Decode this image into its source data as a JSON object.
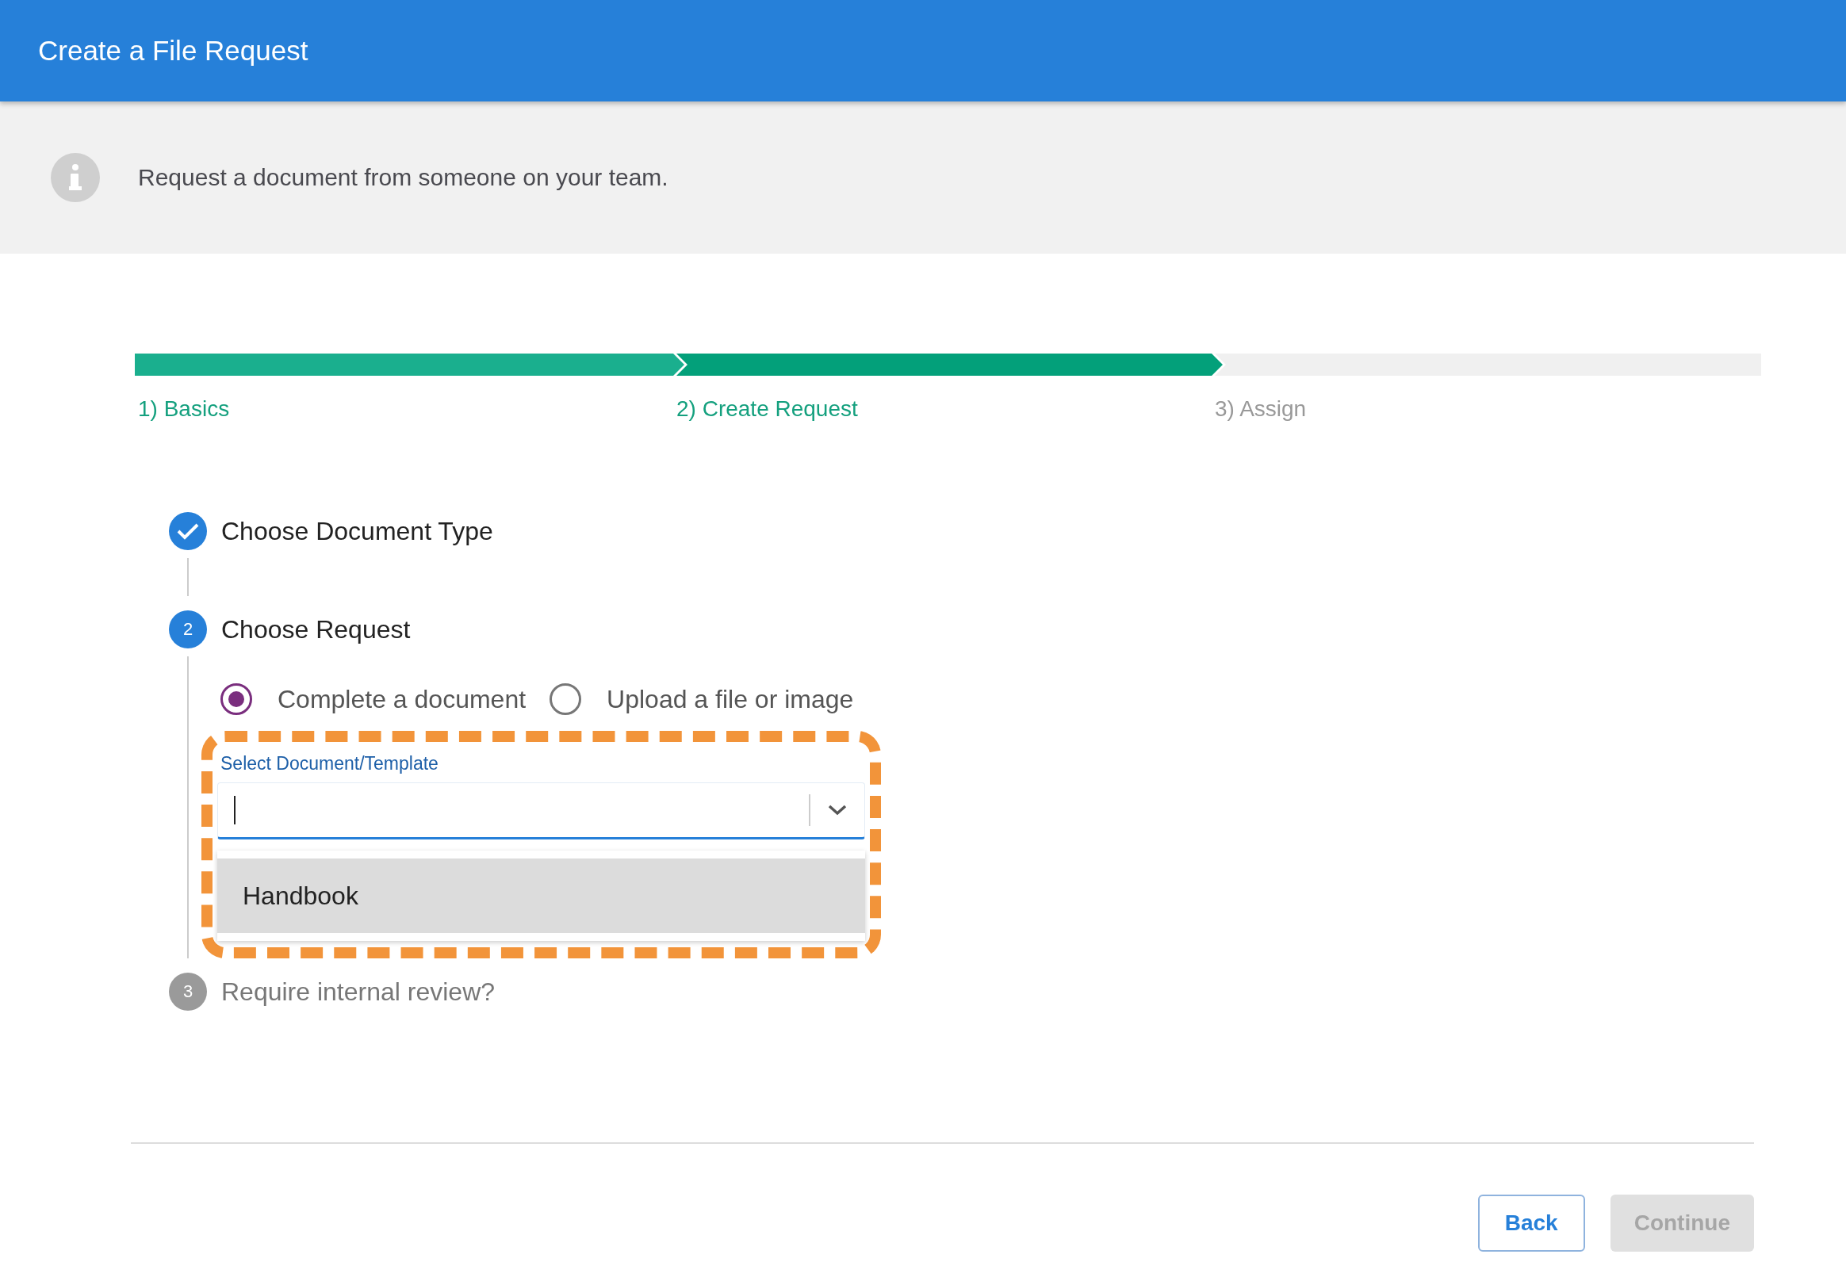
{
  "header": {
    "title": "Create a File Request"
  },
  "info": {
    "text": "Request a document from someone on your team."
  },
  "progress": [
    {
      "label": "1) Basics",
      "kind": "done"
    },
    {
      "label": "2) Create Request",
      "kind": "current"
    },
    {
      "label": "3) Assign",
      "kind": "pending"
    }
  ],
  "steps": [
    {
      "title": "Choose Document Type",
      "kind": "done"
    },
    {
      "title": "Choose Request",
      "kind": "current",
      "marker": "2",
      "radios": [
        {
          "label": "Complete a document",
          "selected": true
        },
        {
          "label": "Upload a file or image",
          "selected": false
        }
      ],
      "field": {
        "label": "Select Document/Template",
        "options": [
          {
            "label": "Handbook",
            "highlighted": true
          }
        ]
      }
    },
    {
      "title": "Require internal review?",
      "kind": "pending",
      "marker": "3"
    }
  ],
  "buttons": [
    {
      "label": "Back",
      "disabled": false,
      "kind": "outline"
    },
    {
      "label": "Continue",
      "disabled": true,
      "kind": "filled"
    }
  ]
}
